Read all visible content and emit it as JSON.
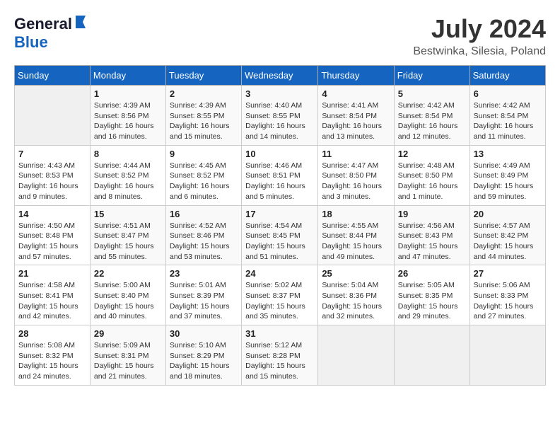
{
  "logo": {
    "general": "General",
    "blue": "Blue"
  },
  "title": {
    "month_year": "July 2024",
    "location": "Bestwinka, Silesia, Poland"
  },
  "weekdays": [
    "Sunday",
    "Monday",
    "Tuesday",
    "Wednesday",
    "Thursday",
    "Friday",
    "Saturday"
  ],
  "weeks": [
    [
      {
        "day": "",
        "content": ""
      },
      {
        "day": "1",
        "content": "Sunrise: 4:39 AM\nSunset: 8:56 PM\nDaylight: 16 hours\nand 16 minutes."
      },
      {
        "day": "2",
        "content": "Sunrise: 4:39 AM\nSunset: 8:55 PM\nDaylight: 16 hours\nand 15 minutes."
      },
      {
        "day": "3",
        "content": "Sunrise: 4:40 AM\nSunset: 8:55 PM\nDaylight: 16 hours\nand 14 minutes."
      },
      {
        "day": "4",
        "content": "Sunrise: 4:41 AM\nSunset: 8:54 PM\nDaylight: 16 hours\nand 13 minutes."
      },
      {
        "day": "5",
        "content": "Sunrise: 4:42 AM\nSunset: 8:54 PM\nDaylight: 16 hours\nand 12 minutes."
      },
      {
        "day": "6",
        "content": "Sunrise: 4:42 AM\nSunset: 8:54 PM\nDaylight: 16 hours\nand 11 minutes."
      }
    ],
    [
      {
        "day": "7",
        "content": "Sunrise: 4:43 AM\nSunset: 8:53 PM\nDaylight: 16 hours\nand 9 minutes."
      },
      {
        "day": "8",
        "content": "Sunrise: 4:44 AM\nSunset: 8:52 PM\nDaylight: 16 hours\nand 8 minutes."
      },
      {
        "day": "9",
        "content": "Sunrise: 4:45 AM\nSunset: 8:52 PM\nDaylight: 16 hours\nand 6 minutes."
      },
      {
        "day": "10",
        "content": "Sunrise: 4:46 AM\nSunset: 8:51 PM\nDaylight: 16 hours\nand 5 minutes."
      },
      {
        "day": "11",
        "content": "Sunrise: 4:47 AM\nSunset: 8:50 PM\nDaylight: 16 hours\nand 3 minutes."
      },
      {
        "day": "12",
        "content": "Sunrise: 4:48 AM\nSunset: 8:50 PM\nDaylight: 16 hours\nand 1 minute."
      },
      {
        "day": "13",
        "content": "Sunrise: 4:49 AM\nSunset: 8:49 PM\nDaylight: 15 hours\nand 59 minutes."
      }
    ],
    [
      {
        "day": "14",
        "content": "Sunrise: 4:50 AM\nSunset: 8:48 PM\nDaylight: 15 hours\nand 57 minutes."
      },
      {
        "day": "15",
        "content": "Sunrise: 4:51 AM\nSunset: 8:47 PM\nDaylight: 15 hours\nand 55 minutes."
      },
      {
        "day": "16",
        "content": "Sunrise: 4:52 AM\nSunset: 8:46 PM\nDaylight: 15 hours\nand 53 minutes."
      },
      {
        "day": "17",
        "content": "Sunrise: 4:54 AM\nSunset: 8:45 PM\nDaylight: 15 hours\nand 51 minutes."
      },
      {
        "day": "18",
        "content": "Sunrise: 4:55 AM\nSunset: 8:44 PM\nDaylight: 15 hours\nand 49 minutes."
      },
      {
        "day": "19",
        "content": "Sunrise: 4:56 AM\nSunset: 8:43 PM\nDaylight: 15 hours\nand 47 minutes."
      },
      {
        "day": "20",
        "content": "Sunrise: 4:57 AM\nSunset: 8:42 PM\nDaylight: 15 hours\nand 44 minutes."
      }
    ],
    [
      {
        "day": "21",
        "content": "Sunrise: 4:58 AM\nSunset: 8:41 PM\nDaylight: 15 hours\nand 42 minutes."
      },
      {
        "day": "22",
        "content": "Sunrise: 5:00 AM\nSunset: 8:40 PM\nDaylight: 15 hours\nand 40 minutes."
      },
      {
        "day": "23",
        "content": "Sunrise: 5:01 AM\nSunset: 8:39 PM\nDaylight: 15 hours\nand 37 minutes."
      },
      {
        "day": "24",
        "content": "Sunrise: 5:02 AM\nSunset: 8:37 PM\nDaylight: 15 hours\nand 35 minutes."
      },
      {
        "day": "25",
        "content": "Sunrise: 5:04 AM\nSunset: 8:36 PM\nDaylight: 15 hours\nand 32 minutes."
      },
      {
        "day": "26",
        "content": "Sunrise: 5:05 AM\nSunset: 8:35 PM\nDaylight: 15 hours\nand 29 minutes."
      },
      {
        "day": "27",
        "content": "Sunrise: 5:06 AM\nSunset: 8:33 PM\nDaylight: 15 hours\nand 27 minutes."
      }
    ],
    [
      {
        "day": "28",
        "content": "Sunrise: 5:08 AM\nSunset: 8:32 PM\nDaylight: 15 hours\nand 24 minutes."
      },
      {
        "day": "29",
        "content": "Sunrise: 5:09 AM\nSunset: 8:31 PM\nDaylight: 15 hours\nand 21 minutes."
      },
      {
        "day": "30",
        "content": "Sunrise: 5:10 AM\nSunset: 8:29 PM\nDaylight: 15 hours\nand 18 minutes."
      },
      {
        "day": "31",
        "content": "Sunrise: 5:12 AM\nSunset: 8:28 PM\nDaylight: 15 hours\nand 15 minutes."
      },
      {
        "day": "",
        "content": ""
      },
      {
        "day": "",
        "content": ""
      },
      {
        "day": "",
        "content": ""
      }
    ]
  ]
}
